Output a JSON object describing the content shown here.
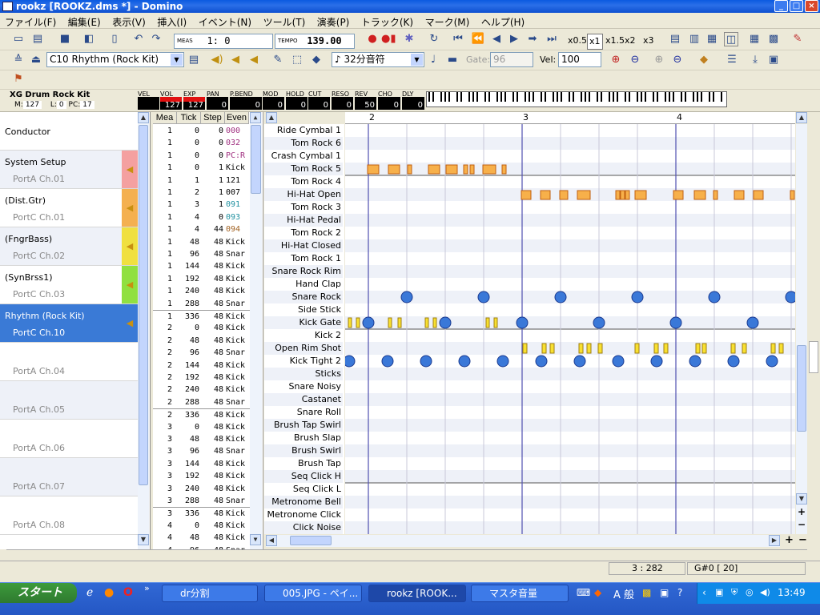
{
  "window": {
    "title": "rookz   [ROOKZ.dms *] - Domino",
    "minimize": "_",
    "maximize": "□",
    "close": "×"
  },
  "menu": [
    "ファイル(F)",
    "編集(E)",
    "表示(V)",
    "挿入(I)",
    "イベント(N)",
    "ツール(T)",
    "演奏(P)",
    "トラック(K)",
    "マーク(M)",
    "ヘルプ(H)"
  ],
  "toolbar1": {
    "meas_label": "MEAS",
    "position": "1:     0",
    "tempo_label": "TEMPO",
    "tempo": "139.00",
    "speed": [
      "x0.5",
      "x1",
      "x1.5",
      "x2",
      "x3"
    ]
  },
  "toolbar2": {
    "track_select": "C10 Rhythm (Rock Kit)",
    "note_length": "32分音符",
    "gate_label": "Gate:",
    "gate": "96",
    "vel_label": "Vel:",
    "vel": "100"
  },
  "channel_strip": {
    "instrument": "XG Drum Rock Kit",
    "m_label": "M:",
    "m": "127",
    "l_label": "L:",
    "l": "0",
    "pc_label": "PC:",
    "pc": "17",
    "meters": [
      {
        "label": "VEL",
        "value": "",
        "red": false
      },
      {
        "label": "VOL",
        "value": "127",
        "red": true
      },
      {
        "label": "EXP",
        "value": "127",
        "red": true
      },
      {
        "label": "PAN",
        "value": "0",
        "red": false
      },
      {
        "label": "P.BEND",
        "value": "0",
        "red": false
      },
      {
        "label": "MOD",
        "value": "0",
        "red": false
      },
      {
        "label": "HOLD",
        "value": "0",
        "red": false
      },
      {
        "label": "CUT",
        "value": "0",
        "red": false
      },
      {
        "label": "RESO",
        "value": "0",
        "red": false
      },
      {
        "label": "REV",
        "value": "50",
        "red": false
      },
      {
        "label": "CHO",
        "value": "0",
        "red": false
      },
      {
        "label": "DLY",
        "value": "0",
        "red": false
      }
    ]
  },
  "tracks": [
    {
      "name": "Conductor",
      "port": "",
      "color": ""
    },
    {
      "name": "System Setup",
      "port": "PortA  Ch.01",
      "color": "#f4a0a0"
    },
    {
      "name": "(Dist.Gtr)",
      "port": "PortC  Ch.01",
      "color": "#f4b050"
    },
    {
      "name": "(FngrBass)",
      "port": "PortC  Ch.02",
      "color": "#f0e040"
    },
    {
      "name": "(SynBrss1)",
      "port": "PortC  Ch.03",
      "color": "#90e040"
    },
    {
      "name": "Rhythm (Rock Kit)",
      "port": "PortC  Ch.10",
      "color": "#3a7ad6"
    },
    {
      "name": "",
      "port": "PortA  Ch.04",
      "color": ""
    },
    {
      "name": "",
      "port": "PortA  Ch.05",
      "color": ""
    },
    {
      "name": "",
      "port": "PortA  Ch.06",
      "color": ""
    },
    {
      "name": "",
      "port": "PortA  Ch.07",
      "color": ""
    },
    {
      "name": "",
      "port": "PortA  Ch.08",
      "color": ""
    }
  ],
  "event_headers": [
    "Mea",
    "Tick",
    "Step",
    "Even"
  ],
  "events": [
    [
      "1",
      "0",
      "0",
      "000",
      "#a03080"
    ],
    [
      "1",
      "0",
      "0",
      "032",
      "#a03080"
    ],
    [
      "1",
      "0",
      "0",
      "PC:R",
      "#a03080"
    ],
    [
      "1",
      "0",
      "1",
      "Kick",
      ""
    ],
    [
      "1",
      "1",
      "1",
      "121",
      ""
    ],
    [
      "1",
      "2",
      "1",
      "007",
      ""
    ],
    [
      "1",
      "3",
      "1",
      "091",
      "#2090a0"
    ],
    [
      "1",
      "4",
      "0",
      "093",
      "#2090a0"
    ],
    [
      "1",
      "4",
      "44",
      "094",
      "#a06020"
    ],
    [
      "1",
      "48",
      "48",
      "Kick",
      ""
    ],
    [
      "1",
      "96",
      "48",
      "Snar",
      ""
    ],
    [
      "1",
      "144",
      "48",
      "Kick",
      ""
    ],
    [
      "1",
      "192",
      "48",
      "Kick",
      ""
    ],
    [
      "1",
      "240",
      "48",
      "Kick",
      ""
    ],
    [
      "1",
      "288",
      "48",
      "Snar",
      ""
    ],
    [
      "1",
      "336",
      "48",
      "Kick",
      ""
    ],
    [
      "2",
      "0",
      "48",
      "Kick",
      ""
    ],
    [
      "2",
      "48",
      "48",
      "Kick",
      ""
    ],
    [
      "2",
      "96",
      "48",
      "Snar",
      ""
    ],
    [
      "2",
      "144",
      "48",
      "Kick",
      ""
    ],
    [
      "2",
      "192",
      "48",
      "Kick",
      ""
    ],
    [
      "2",
      "240",
      "48",
      "Kick",
      ""
    ],
    [
      "2",
      "288",
      "48",
      "Snar",
      ""
    ],
    [
      "2",
      "336",
      "48",
      "Kick",
      ""
    ],
    [
      "3",
      "0",
      "48",
      "Kick",
      ""
    ],
    [
      "3",
      "48",
      "48",
      "Kick",
      ""
    ],
    [
      "3",
      "96",
      "48",
      "Snar",
      ""
    ],
    [
      "3",
      "144",
      "48",
      "Kick",
      ""
    ],
    [
      "3",
      "192",
      "48",
      "Kick",
      ""
    ],
    [
      "3",
      "240",
      "48",
      "Kick",
      ""
    ],
    [
      "3",
      "288",
      "48",
      "Snar",
      ""
    ],
    [
      "3",
      "336",
      "48",
      "Kick",
      ""
    ],
    [
      "4",
      "0",
      "48",
      "Kick",
      ""
    ],
    [
      "4",
      "48",
      "48",
      "Kick",
      ""
    ],
    [
      "4",
      "96",
      "48",
      "Snar",
      ""
    ]
  ],
  "ruler_marks": [
    "2",
    "3",
    "4"
  ],
  "drum_names": [
    "Ride Cymbal 1",
    "Tom Rock 6",
    "Crash Cymbal 1",
    "Tom Rock 5",
    "Tom Rock 4",
    "Hi-Hat Open",
    "Tom Rock 3",
    "Hi-Hat Pedal",
    "Tom Rock 2",
    "Hi-Hat Closed",
    "Tom Rock 1",
    "Snare Rock Rim",
    "Hand Clap",
    "Snare Rock",
    "Side Stick",
    "Kick Gate",
    "Kick 2",
    "Open Rim Shot",
    "Kick Tight 2",
    "Sticks",
    "Snare Noisy",
    "Castanet",
    "Snare Roll",
    "Brush Tap Swirl",
    "Brush Slap",
    "Brush Swirl",
    "Brush Tap",
    "Seq Click H",
    "Seq Click L",
    "Metronome Bell",
    "Metronome Click",
    "Click Noise"
  ],
  "status": {
    "position": "3 : 282",
    "note": "G#0 [ 20]"
  },
  "taskbar": {
    "start": "スタート",
    "tasks": [
      "dr分割",
      "005.JPG - ペイ...",
      "rookz   [ROOK...",
      "マスタ音量"
    ],
    "ime": "A 般",
    "clock": "13:49"
  }
}
